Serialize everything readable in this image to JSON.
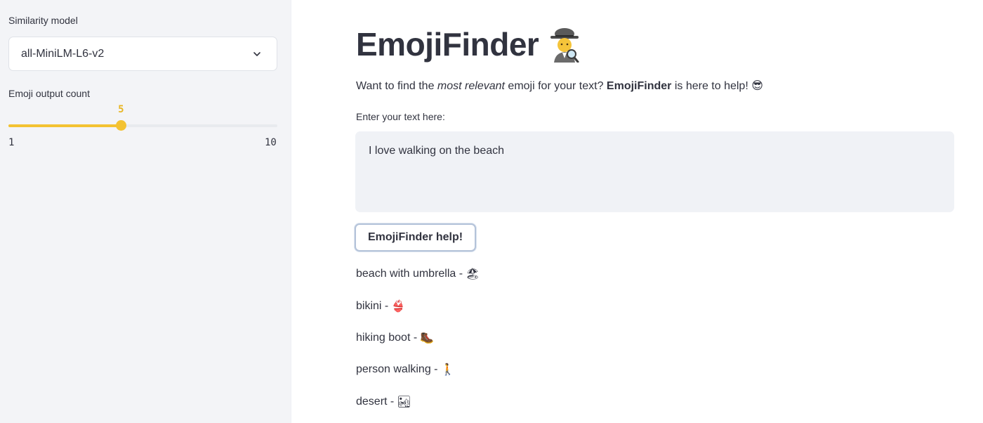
{
  "sidebar": {
    "model_label": "Similarity model",
    "model_value": "all-MiniLM-L6-v2",
    "count_label": "Emoji output count",
    "slider": {
      "value": 5,
      "min": 1,
      "max": 10,
      "value_text": "5",
      "min_text": "1",
      "max_text": "10"
    }
  },
  "main": {
    "title": "EmojiFinder",
    "title_emoji": "🕵",
    "intro": {
      "part1": "Want to find the ",
      "part2": "most relevant",
      "part3": " emoji for your text? ",
      "part4": "EmojiFinder",
      "part5": " is here to help! ",
      "emoji": "😎"
    },
    "input_label": "Enter your text here:",
    "input_value": "I love walking on the beach",
    "button_label": "EmojiFinder help!",
    "results": [
      {
        "name": "beach with umbrella -",
        "emoji": "🏖"
      },
      {
        "name": "bikini -",
        "emoji": "👙"
      },
      {
        "name": "hiking boot -",
        "emoji": "🥾"
      },
      {
        "name": "person walking -",
        "emoji": "🚶"
      },
      {
        "name": "desert -",
        "emoji": "🏜"
      }
    ]
  },
  "colors": {
    "accent": "#f3c232",
    "sidebar_bg": "#f3f4f7",
    "input_bg": "#f0f2f6",
    "text": "#31333f"
  }
}
